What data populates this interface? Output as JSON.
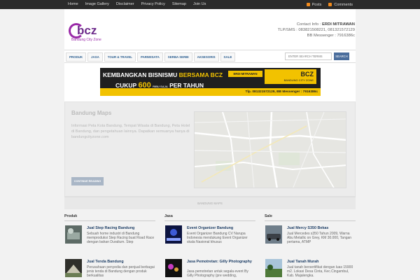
{
  "topnav": [
    "Home",
    "Image Gallery",
    "Disclaimer",
    "Privacy Policy",
    "Sitemap",
    "Join Us"
  ],
  "toplinks": [
    "Posts",
    "Comments"
  ],
  "logo": {
    "text": "bcz",
    "subtitle": "Bandung City Zone"
  },
  "contact": {
    "label": "Contact Info :",
    "name": "ERDI MITRAWAN",
    "phones": "TLP/SMS : 083821508221, 081321572129",
    "bbm": "BB Messenger : 7916386c"
  },
  "menu": [
    "PRODUK",
    "JASA",
    "TOUR & TRAVEL",
    "PARIWISATA",
    "SERBA SERBI",
    "AKSESORIS",
    "SALE"
  ],
  "search": {
    "placeholder": "ENTER SEARCH TERMS",
    "button": "SEARCH"
  },
  "banner": {
    "line1_a": "KEMBANGKAN BISNISMU ",
    "line1_b": "BERSAMA BCZ",
    "line2_a": "CUKUP ",
    "line2_num": "600",
    "line2_small": "RIBU SAJA",
    "line2_b": " PER TAHUN",
    "tag": "ERDI MITRAWAN",
    "card_title": "BCZ",
    "card_sub": "BANDUNG CITY ZONE",
    "footer": "Tlp. 081321572129, BB Messenger : 7916386c"
  },
  "feature": {
    "title": "Bandung Maps",
    "description": "Informasi Peta Kota Bandung, Tempat Wisata di Bandung, Peta Hotel di Bandung, dan pengetahuan lainnya. Dapatkan semuanya hanya di bandungcityzone.com",
    "button": "CONTINUE READING",
    "caption": "BANDUNG MAPS"
  },
  "columns": [
    {
      "title": "Produk",
      "posts": [
        {
          "title": "Jual Step Racing Bandung",
          "text": "Sebuah home industri di Bandung memproduksi Step Racing buat Road Race dengan bahan Duralium. Step",
          "two_line": false
        },
        {
          "title": "Jual Tenda Bandung",
          "text": "Perusahaan penyedia dan penjual berbagai jenis tenda di Bandung dengan produk berkualitas",
          "two_line": false
        }
      ]
    },
    {
      "title": "Jasa",
      "posts": [
        {
          "title": "Event Organizer Bandung",
          "text": "Event Organizer Bandung CV Narupa Indonesia mendukung Event Organizer skala Nasional khusus",
          "two_line": false
        },
        {
          "title": "Jasa Pemotretan: Gilly Photography",
          "text": "Jasa pemotretan untuk segala event By Gilly Photography (pre wedding,",
          "two_line": true
        }
      ]
    },
    {
      "title": "Sale",
      "posts": [
        {
          "title": "Jual Mercy S350 Bekas",
          "text": "Jual Mercedes s350 Tahun 2009, Warna Abu Metallic on Grey, KM 30.000, Tangan pertama, ATMP",
          "two_line": false
        },
        {
          "title": "Jual Tanah Murah",
          "text": "Jual tanah bersertifikat dengan luas 15900 m2. Lokasi Desa Cinta, Kec.Cingambul, Kab. Majalengka.",
          "two_line": false
        }
      ]
    }
  ]
}
